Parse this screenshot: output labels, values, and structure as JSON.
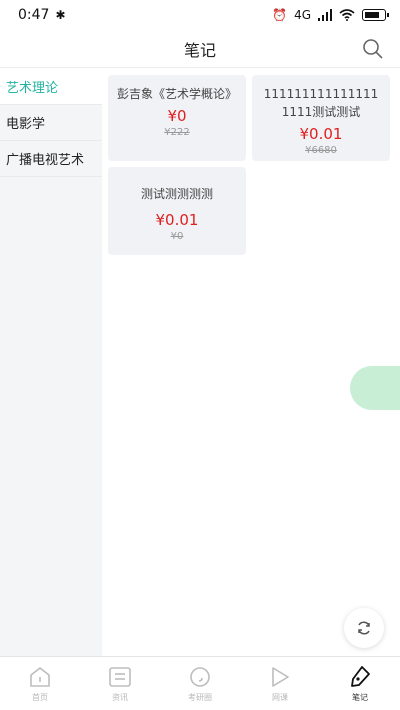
{
  "status_bar": {
    "time": "0:47",
    "bluetooth_icon": "bluetooth-icon",
    "signal_text": "4G",
    "icons": [
      "alarm-icon",
      "signal-icon",
      "wifi-icon",
      "battery-icon"
    ]
  },
  "header": {
    "title": "笔记",
    "search_icon": "search-icon"
  },
  "sidebar": {
    "items": [
      {
        "label": "艺术理论",
        "active": true
      },
      {
        "label": "电影学",
        "active": false
      },
      {
        "label": "广播电视艺术",
        "active": false
      }
    ]
  },
  "cards": [
    {
      "title": "彭吉象《艺术学概论》",
      "price": "¥0",
      "original_price": "¥222"
    },
    {
      "title": "1111111111111111111测试测试",
      "price": "¥0.01",
      "original_price": "¥6680"
    },
    {
      "title": "测试测测测测",
      "price": "¥0.01",
      "original_price": "¥0"
    }
  ],
  "floating": {
    "refresh_icon": "refresh-icon"
  },
  "tabbar": {
    "items": [
      {
        "label": "首页",
        "icon": "home-icon",
        "active": false
      },
      {
        "label": "资讯",
        "icon": "news-icon",
        "active": false
      },
      {
        "label": "考研圈",
        "icon": "circle-icon",
        "active": false
      },
      {
        "label": "网课",
        "icon": "play-icon",
        "active": false
      },
      {
        "label": "笔记",
        "icon": "pen-icon",
        "active": true
      }
    ]
  },
  "colors": {
    "accent": "#22b3a3",
    "price_red": "#e02020",
    "sidebar_bg": "#f4f5f7",
    "card_bg": "#f1f2f5",
    "bubble": "#c9eed6"
  }
}
